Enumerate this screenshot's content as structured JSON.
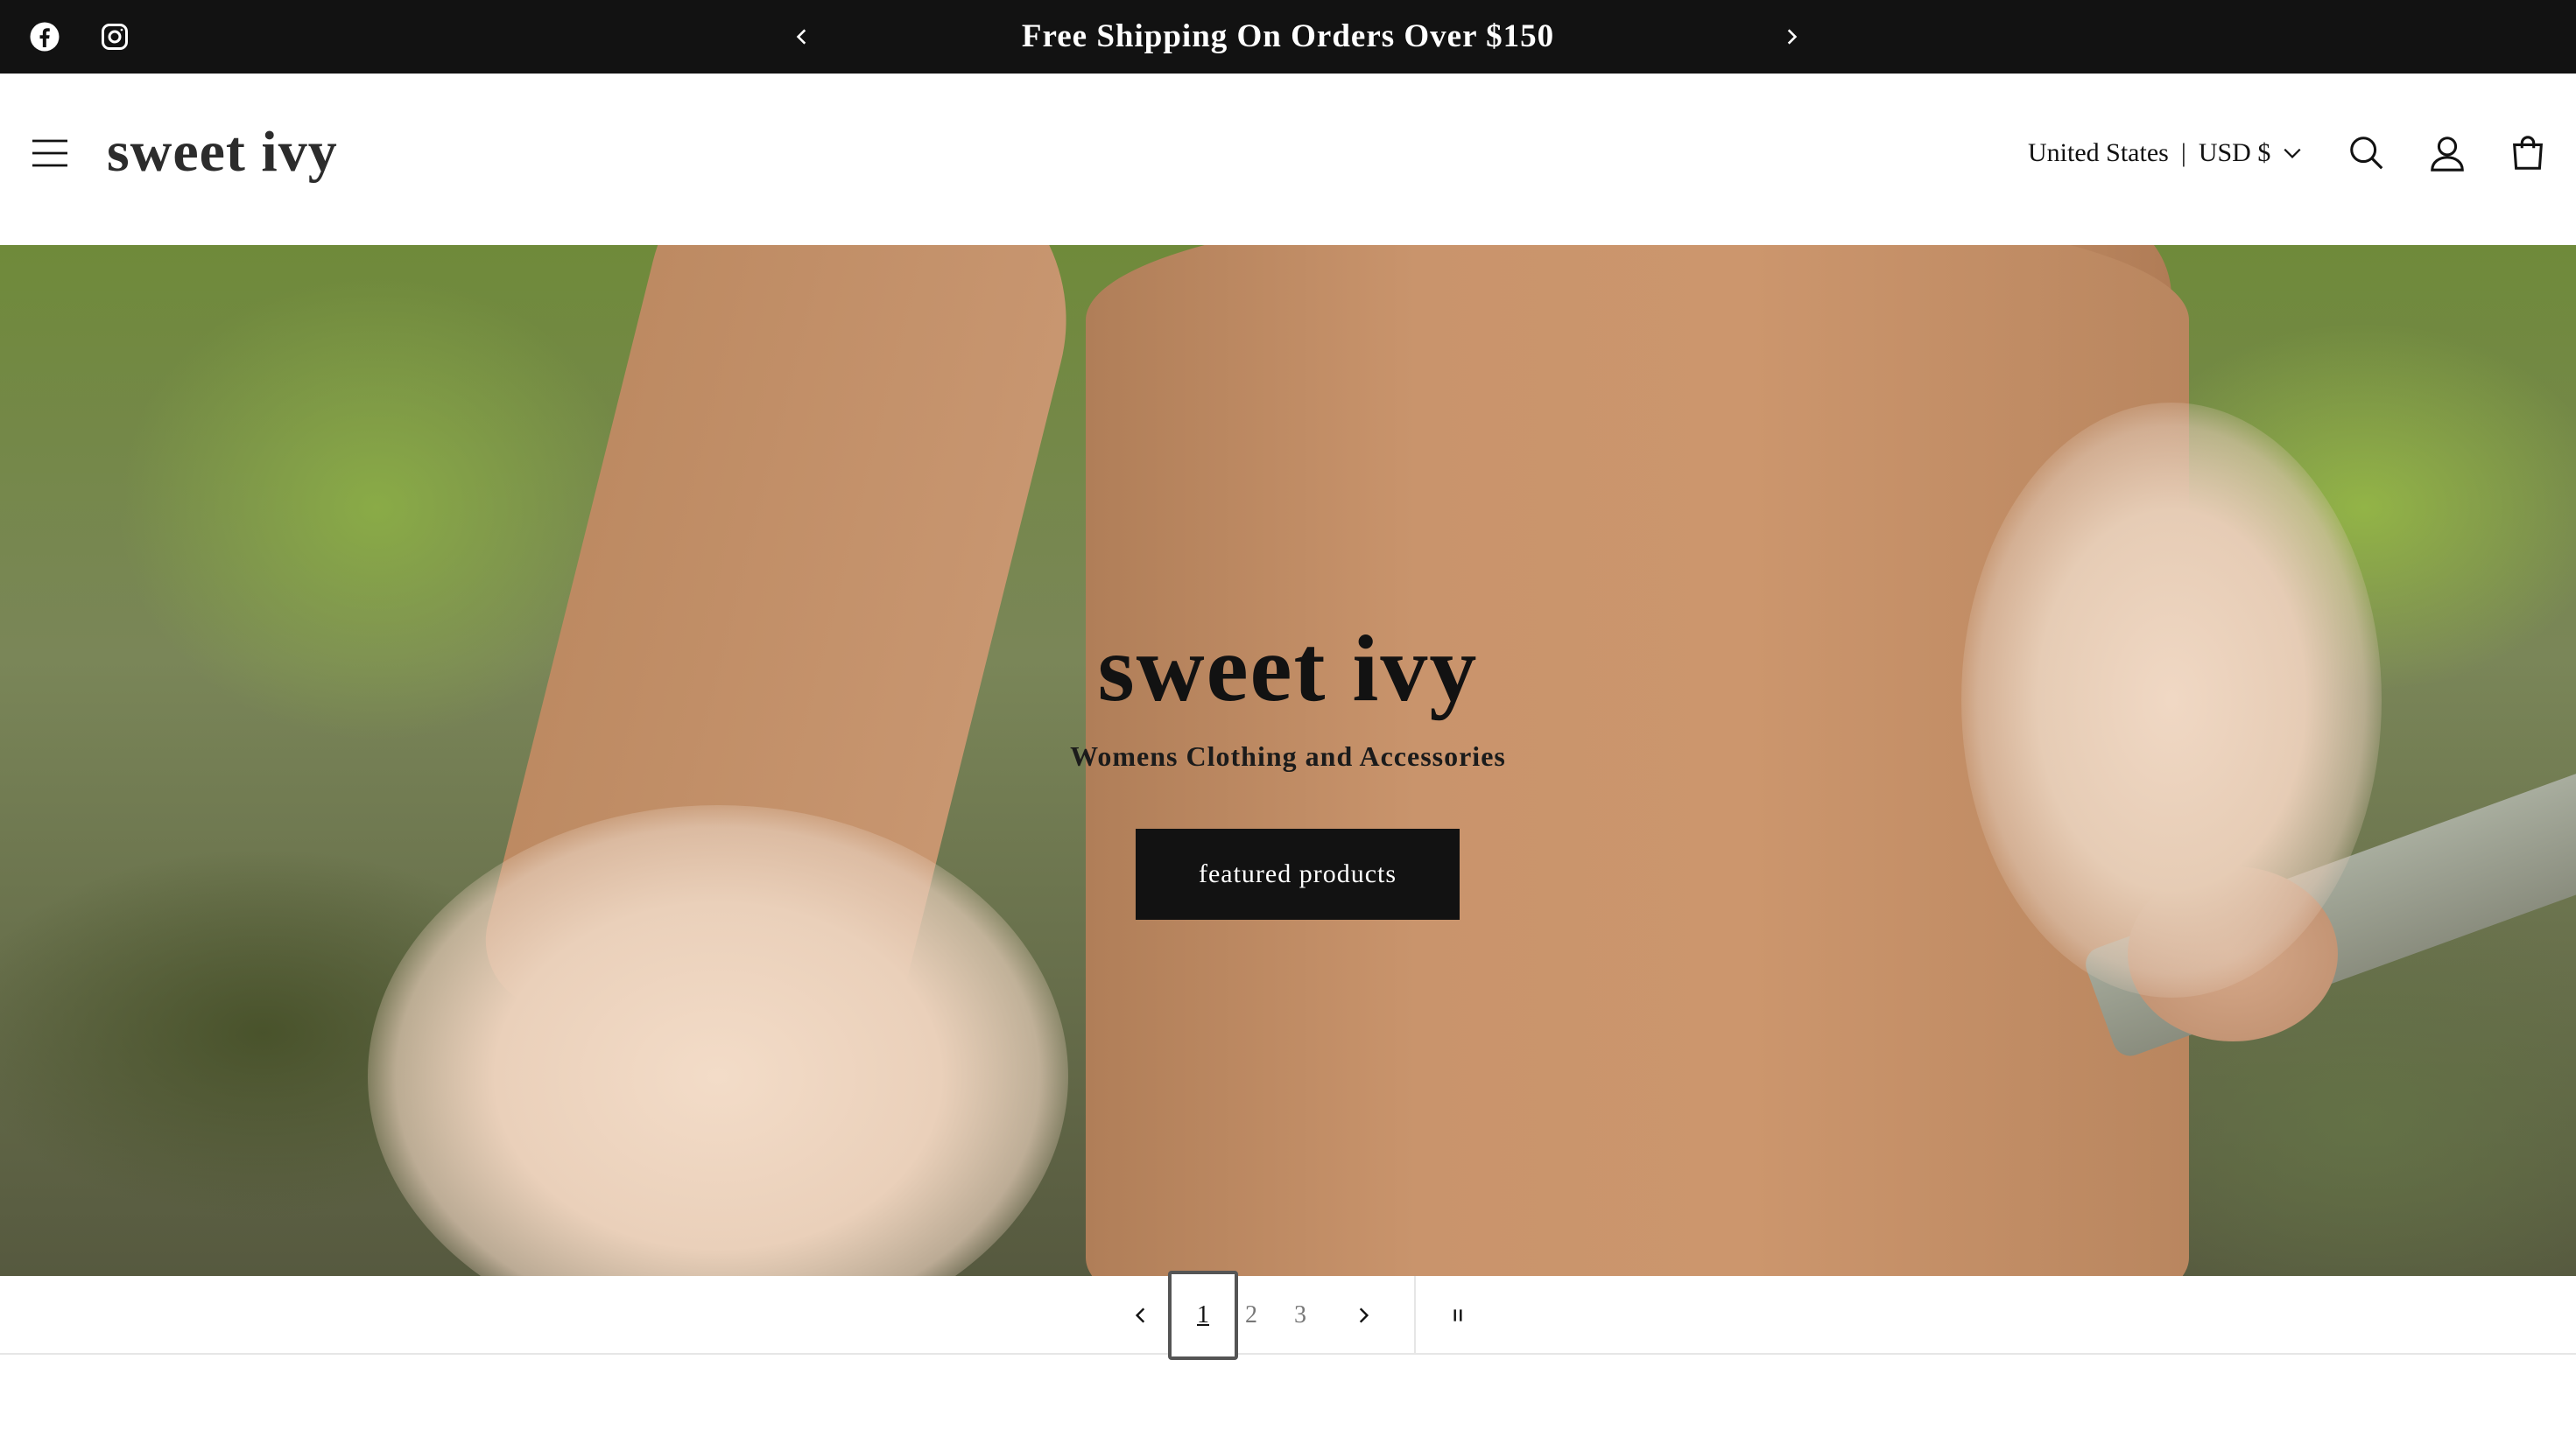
{
  "announcement": {
    "text": "Free Shipping On Orders Over $150",
    "social": [
      "facebook-icon",
      "instagram-icon"
    ],
    "prev_icon": "chevron-left-icon",
    "next_icon": "chevron-right-icon"
  },
  "header": {
    "logo": "sweet ivy",
    "menu_icon": "hamburger-menu-icon",
    "locale": {
      "country": "United States",
      "separator": "|",
      "currency": "USD $"
    },
    "icons": [
      "search-icon",
      "account-icon",
      "cart-icon"
    ]
  },
  "hero": {
    "title": "sweet ivy",
    "subtitle": "Womens Clothing and Accessories",
    "button_label": "featured products"
  },
  "slider": {
    "slides": [
      "1",
      "2",
      "3"
    ],
    "active_slide": "1",
    "pause_icon": "pause-icon"
  },
  "colors": {
    "announcement_bg": "#121212",
    "button_bg": "#121212",
    "text": "#121212",
    "background": "#ffffff"
  }
}
